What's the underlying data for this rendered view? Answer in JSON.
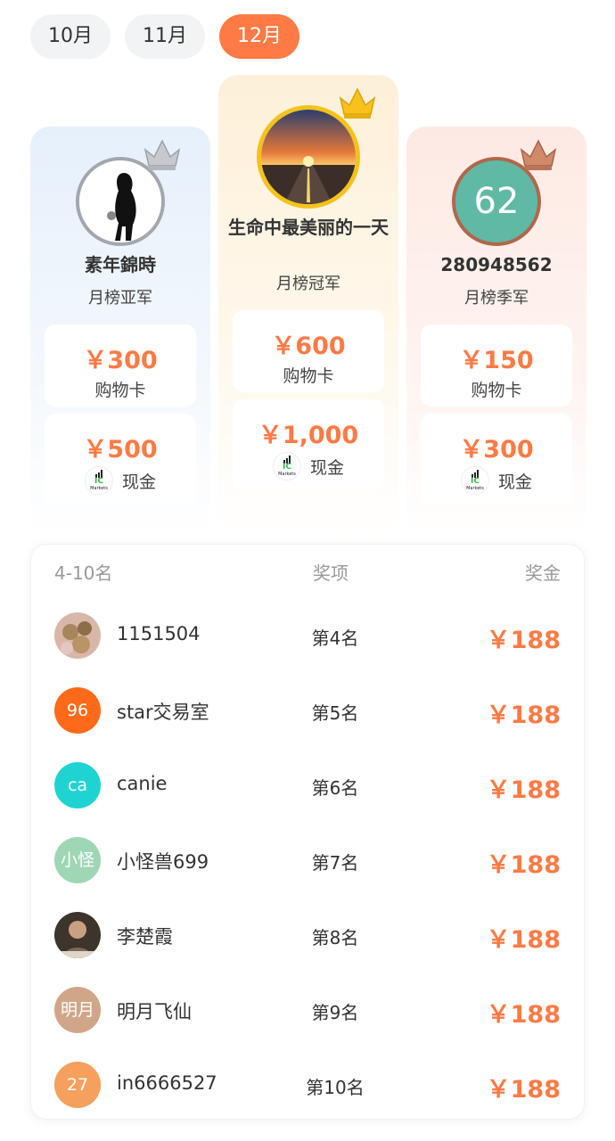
{
  "months": [
    {
      "label": "10月",
      "active": false
    },
    {
      "label": "11月",
      "active": false
    },
    {
      "label": "12月",
      "active": true
    }
  ],
  "colors": {
    "accent": "#ff7a45",
    "gold": "#f4c21a",
    "silver": "#a3a6ad",
    "bronze": "#b0674a"
  },
  "podium": {
    "second": {
      "name": "素年錦時",
      "title": "月榜亚军",
      "prize1": {
        "amount": "￥300",
        "label": "购物卡"
      },
      "prize2": {
        "amount": "￥500",
        "label": "现金",
        "logo": "ic-markets-logo"
      }
    },
    "first": {
      "name": "生命中最美丽的一天",
      "title": "月榜冠军",
      "prize1": {
        "amount": "￥600",
        "label": "购物卡"
      },
      "prize2": {
        "amount": "￥1,000",
        "label": "现金",
        "logo": "ic-markets-logo"
      }
    },
    "third": {
      "name": "280948562",
      "title": "月榜季军",
      "avatar_text": "62",
      "prize1": {
        "amount": "￥150",
        "label": "购物卡"
      },
      "prize2": {
        "amount": "￥300",
        "label": "现金",
        "logo": "ic-markets-logo"
      }
    }
  },
  "logo_text": {
    "ic": "IC",
    "markets": "Markets"
  },
  "table": {
    "headers": {
      "name": "4-10名",
      "item": "奖项",
      "money": "奖金"
    },
    "rows": [
      {
        "name": "1151504",
        "item": "第4名",
        "money": "￥188",
        "avatar_text": "",
        "avatar_color": "#c9a58a"
      },
      {
        "name": "star交易室",
        "item": "第5名",
        "money": "￥188",
        "avatar_text": "96",
        "avatar_color": "#ff6a1a"
      },
      {
        "name": "canie",
        "item": "第6名",
        "money": "￥188",
        "avatar_text": "ca",
        "avatar_color": "#1fd3d3"
      },
      {
        "name": "小怪兽699",
        "item": "第7名",
        "money": "￥188",
        "avatar_text": "小怪",
        "avatar_color": "#9fd7b4"
      },
      {
        "name": "李楚霞",
        "item": "第8名",
        "money": "￥188",
        "avatar_text": "",
        "avatar_color": "#6b5a4a"
      },
      {
        "name": "明月飞仙",
        "item": "第9名",
        "money": "￥188",
        "avatar_text": "明月",
        "avatar_color": "#d1a688"
      },
      {
        "name": "in6666527",
        "item": "第10名",
        "money": "￥188",
        "avatar_text": "27",
        "avatar_color": "#f5a05c"
      }
    ]
  }
}
